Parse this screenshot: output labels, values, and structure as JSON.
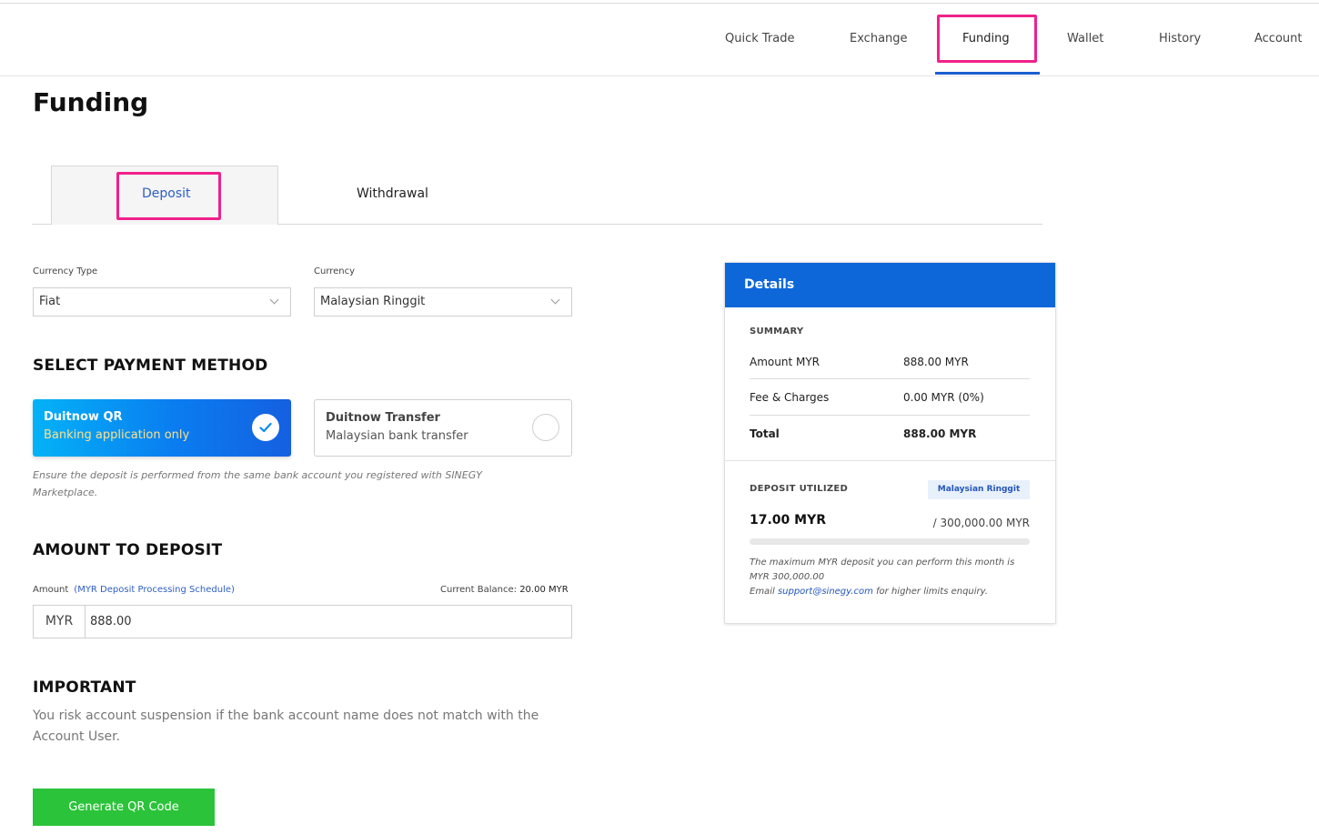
{
  "nav": {
    "items": [
      {
        "label": "Quick Trade"
      },
      {
        "label": "Exchange"
      },
      {
        "label": "Funding"
      },
      {
        "label": "Wallet"
      },
      {
        "label": "History"
      },
      {
        "label": "Account"
      }
    ],
    "active": "Funding"
  },
  "page": {
    "title": "Funding"
  },
  "tabs": {
    "deposit": "Deposit",
    "withdrawal": "Withdrawal",
    "active": "Deposit"
  },
  "filters": {
    "currency_type_label": "Currency Type",
    "currency_type_value": "Fiat",
    "currency_label": "Currency",
    "currency_value": "Malaysian Ringgit"
  },
  "payment": {
    "heading": "SELECT PAYMENT METHOD",
    "methods": [
      {
        "title": "Duitnow QR",
        "subtitle": "Banking application only",
        "selected": true
      },
      {
        "title": "Duitnow Transfer",
        "subtitle": "Malaysian bank transfer",
        "selected": false
      }
    ],
    "note": "Ensure the deposit is performed from the same bank account you registered with SINEGY Marketplace."
  },
  "amount": {
    "heading": "AMOUNT TO DEPOSIT",
    "label": "Amount",
    "schedule_link": "(MYR Deposit Processing Schedule)",
    "balance_label": "Current Balance:",
    "balance_value": "20.00 MYR",
    "currency_prefix": "MYR",
    "value": "888.00"
  },
  "important": {
    "heading": "IMPORTANT",
    "text": "You risk account suspension if the bank account name does not match with the Account User."
  },
  "actions": {
    "generate_label": "Generate QR Code"
  },
  "details": {
    "title": "Details",
    "summary_heading": "SUMMARY",
    "rows": [
      {
        "label": "Amount MYR",
        "value": "888.00 MYR"
      },
      {
        "label": "Fee & Charges",
        "value": "0.00 MYR (0%)"
      },
      {
        "label": "Total",
        "value": "888.00 MYR"
      }
    ],
    "deposit_utilized_heading": "DEPOSIT UTILIZED",
    "badge": "Malaysian Ringgit",
    "utilized_value": "17.00 MYR",
    "limit_value": "/ 300,000.00 MYR",
    "progress_fraction": 5.67e-05,
    "note_line1": "The maximum MYR deposit you can perform this month is MYR 300,000.00",
    "note_email_prefix": "Email",
    "note_email": "support@sinegy.com",
    "note_email_suffix": "for higher limits enquiry."
  },
  "colors": {
    "accent_blue": "#0e67d9",
    "highlight_pink": "#f0218a",
    "button_green": "#2bc339",
    "link_blue": "#2d5fc4"
  }
}
